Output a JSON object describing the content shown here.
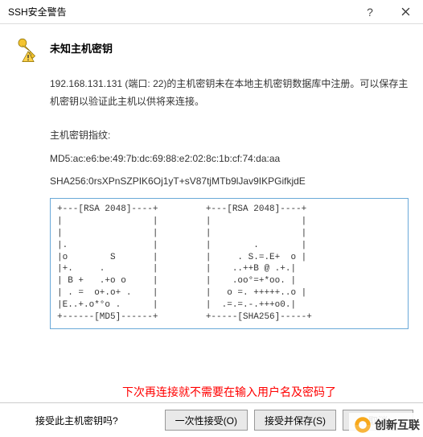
{
  "titlebar": {
    "title": "SSH安全警告"
  },
  "header": {
    "title": "未知主机密钥"
  },
  "message": "192.168.131.131 (端口: 22)的主机密钥未在本地主机密钥数据库中注册。可以保存主机密钥以验证此主机以供将来连接。",
  "fingerprint": {
    "label": "主机密钥指纹:",
    "md5": "MD5:ac:e6:be:49:7b:dc:69:88:e2:02:8c:1b:cf:74:da:aa",
    "sha256": "SHA256:0rsXPnSZPIK6Oj1yT+sV87tjMTb9lJav9IKPGifkjdE"
  },
  "art": "+---[RSA 2048]----+         +---[RSA 2048]----+\n|                 |         |                 |\n|                 |         |                 |\n|.                |         |        .        |\n|o        S       |         |     . S.=.E+  o |\n|+.     .         |         |    ..++B @ .+.|\n| B +   .+o o     |         |    .oo°=+*oo. |\n| . =  o+.o+ .    |         |   o =. +++++..o |\n|E..+.o*°o .      |         |  .=.=.-.+++o0.|\n+------[MD5]------+         +-----[SHA256]-----+",
  "annotation": "下次再连接就不需要在输入用户名及密码了",
  "footer": {
    "question": "接受此主机密钥吗?",
    "btn_once": "一次性接受(O)",
    "btn_save": "接受并保存(S)",
    "btn_cancel": "取消"
  },
  "watermark": "创新互联"
}
